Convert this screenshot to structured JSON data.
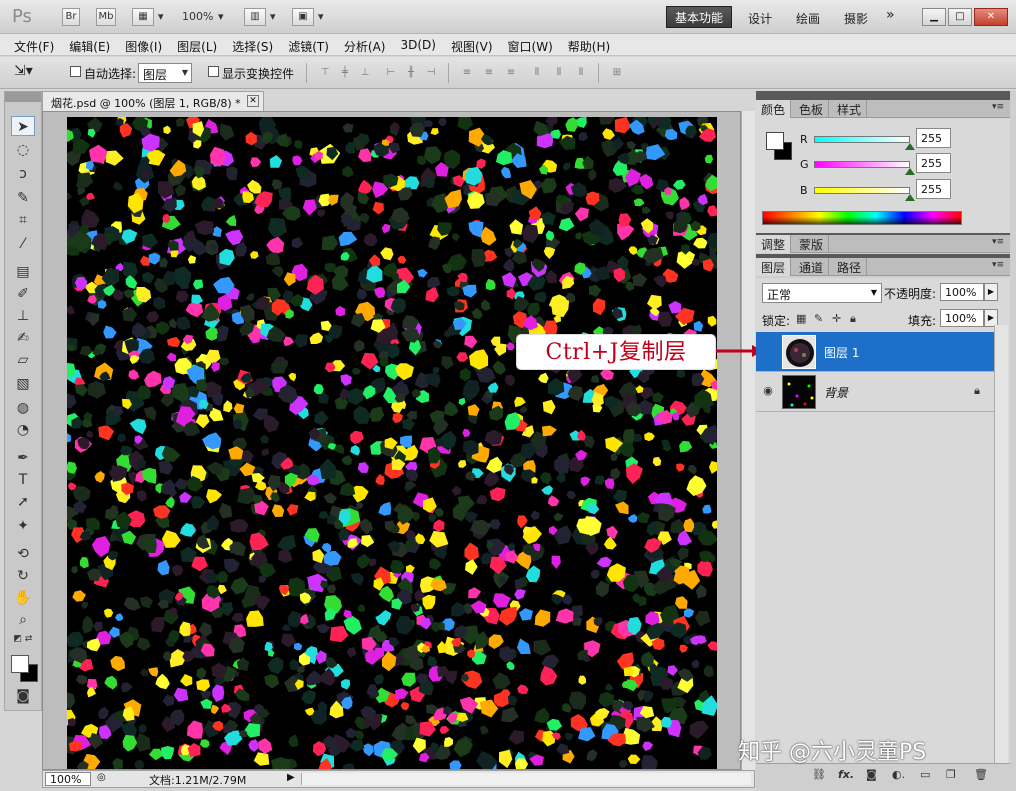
{
  "titlebar": {
    "logo": "Ps",
    "bridge_button": "Br",
    "minibridge_button": "Mb",
    "zoom_level": "100%",
    "workspace_active": "基本功能",
    "workspaces": [
      "设计",
      "绘画",
      "摄影"
    ],
    "more": "»"
  },
  "menu": [
    "文件(F)",
    "编辑(E)",
    "图像(I)",
    "图层(L)",
    "选择(S)",
    "滤镜(T)",
    "分析(A)",
    "3D(D)",
    "视图(V)",
    "窗口(W)",
    "帮助(H)"
  ],
  "options": {
    "auto_select_label": "自动选择:",
    "auto_select_value": "图层",
    "show_transform_label": "显示变换控件"
  },
  "document": {
    "tab_title": "烟花.psd @ 100% (图层 1, RGB/8) *",
    "zoom": "100%",
    "doc_info": "文档:1.21M/2.79M"
  },
  "callout": {
    "text": "Ctrl+J复制层",
    "color": "#c0001a"
  },
  "color_panel": {
    "tabs": [
      "颜色",
      "色板",
      "样式"
    ],
    "channels": [
      {
        "label": "R",
        "value": "255",
        "gradient": "linear-gradient(90deg,#00ffff,#ffffff)"
      },
      {
        "label": "G",
        "value": "255",
        "gradient": "linear-gradient(90deg,#ff00ff,#ffffff)"
      },
      {
        "label": "B",
        "value": "255",
        "gradient": "linear-gradient(90deg,#ffff00,#ffffff)"
      }
    ]
  },
  "adjust_panel": {
    "tabs": [
      "调整",
      "蒙版"
    ]
  },
  "layers_panel": {
    "tabs": [
      "图层",
      "通道",
      "路径"
    ],
    "blend_mode": "正常",
    "opacity_label": "不透明度:",
    "opacity_value": "100%",
    "lock_label": "锁定:",
    "fill_label": "填充:",
    "fill_value": "100%",
    "layers": [
      {
        "name": "图层 1",
        "selected": true,
        "visible": false
      },
      {
        "name": "背景",
        "selected": false,
        "visible": true,
        "locked": true
      }
    ],
    "footer_icons": [
      "link-icon",
      "fx-icon",
      "mask-icon",
      "adjustment-icon",
      "group-icon",
      "new-layer-icon",
      "trash-icon"
    ]
  },
  "watermark": "知乎 @六小灵童PS",
  "accent_color": "#1d6fc8"
}
